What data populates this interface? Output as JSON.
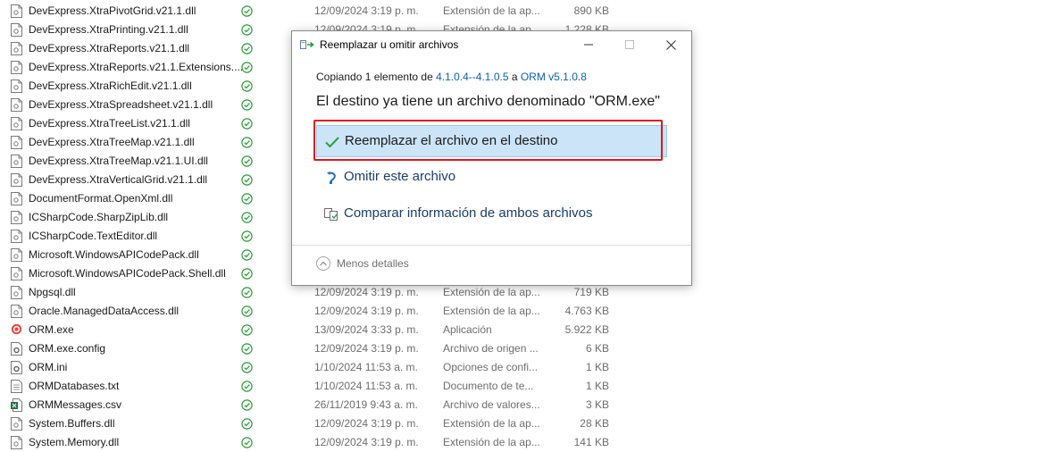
{
  "files": [
    {
      "name": "DevExpress.XtraPivotGrid.v21.1.dll",
      "date": "12/09/2024 3:19 p. m.",
      "type": "Extensión de la ap...",
      "size": "890 KB",
      "icon": "dll-file-icon"
    },
    {
      "name": "DevExpress.XtraPrinting.v21.1.dll",
      "date": "12/09/2024 3:19 p. m.",
      "type": "Extensión de la ap...",
      "size": "1.228 KB",
      "icon": "dll-file-icon"
    },
    {
      "name": "DevExpress.XtraReports.v21.1.dll",
      "date": "",
      "type": "",
      "size": "",
      "icon": "dll-file-icon"
    },
    {
      "name": "DevExpress.XtraReports.v21.1.Extensions....",
      "date": "",
      "type": "",
      "size": "",
      "icon": "dll-file-icon"
    },
    {
      "name": "DevExpress.XtraRichEdit.v21.1.dll",
      "date": "",
      "type": "",
      "size": "",
      "icon": "dll-file-icon"
    },
    {
      "name": "DevExpress.XtraSpreadsheet.v21.1.dll",
      "date": "",
      "type": "",
      "size": "",
      "icon": "dll-file-icon"
    },
    {
      "name": "DevExpress.XtraTreeList.v21.1.dll",
      "date": "",
      "type": "",
      "size": "",
      "icon": "dll-file-icon"
    },
    {
      "name": "DevExpress.XtraTreeMap.v21.1.dll",
      "date": "",
      "type": "",
      "size": "",
      "icon": "dll-file-icon"
    },
    {
      "name": "DevExpress.XtraTreeMap.v21.1.UI.dll",
      "date": "",
      "type": "",
      "size": "",
      "icon": "dll-file-icon"
    },
    {
      "name": "DevExpress.XtraVerticalGrid.v21.1.dll",
      "date": "",
      "type": "",
      "size": "",
      "icon": "dll-file-icon"
    },
    {
      "name": "DocumentFormat.OpenXml.dll",
      "date": "",
      "type": "",
      "size": "",
      "icon": "dll-file-icon"
    },
    {
      "name": "ICSharpCode.SharpZipLib.dll",
      "date": "",
      "type": "",
      "size": "",
      "icon": "dll-file-icon"
    },
    {
      "name": "ICSharpCode.TextEditor.dll",
      "date": "",
      "type": "",
      "size": "",
      "icon": "dll-file-icon"
    },
    {
      "name": "Microsoft.WindowsAPICodePack.dll",
      "date": "",
      "type": "",
      "size": "",
      "icon": "dll-file-icon"
    },
    {
      "name": "Microsoft.WindowsAPICodePack.Shell.dll",
      "date": "",
      "type": "",
      "size": "",
      "icon": "dll-file-icon"
    },
    {
      "name": "Npgsql.dll",
      "date": "12/09/2024 3:19 p. m.",
      "type": "Extensión de la ap...",
      "size": "719 KB",
      "icon": "dll-file-icon"
    },
    {
      "name": "Oracle.ManagedDataAccess.dll",
      "date": "12/09/2024 3:19 p. m.",
      "type": "Extensión de la ap...",
      "size": "4.763 KB",
      "icon": "dll-file-icon"
    },
    {
      "name": "ORM.exe",
      "date": "13/09/2024 3:33 p. m.",
      "type": "Aplicación",
      "size": "5.922 KB",
      "icon": "exe-app-icon"
    },
    {
      "name": "ORM.exe.config",
      "date": "12/09/2024 3:19 p. m.",
      "type": "Archivo de origen ...",
      "size": "6 KB",
      "icon": "config-file-icon"
    },
    {
      "name": "ORM.ini",
      "date": "1/10/2024 11:53 a. m.",
      "type": "Opciones de confi...",
      "size": "1 KB",
      "icon": "ini-file-icon"
    },
    {
      "name": "ORMDatabases.txt",
      "date": "1/10/2024 11:53 a. m.",
      "type": "Documento de te...",
      "size": "1 KB",
      "icon": "text-file-icon"
    },
    {
      "name": "ORMMessages.csv",
      "date": "26/11/2019 9:43 a. m.",
      "type": "Archivo de valores...",
      "size": "3 KB",
      "icon": "csv-file-icon"
    },
    {
      "name": "System.Buffers.dll",
      "date": "12/09/2024 3:19 p. m.",
      "type": "Extensión de la ap...",
      "size": "28 KB",
      "icon": "dll-file-icon"
    },
    {
      "name": "System.Memory.dll",
      "date": "12/09/2024 3:19 p. m.",
      "type": "Extensión de la ap...",
      "size": "141 KB",
      "icon": "dll-file-icon"
    }
  ],
  "dialog": {
    "title": "Reemplazar u omitir archivos",
    "copy_prefix": "Copiando 1 elemento de ",
    "copy_source": "4.1.0.4--4.1.0.5",
    "copy_mid": " a ",
    "copy_dest": "ORM v5.1.0.8",
    "heading": "El destino ya tiene un archivo denominado \"ORM.exe\"",
    "options": [
      {
        "label": "Reemplazar el archivo en el destino",
        "icon": "checkmark-icon"
      },
      {
        "label": "Omitir este archivo",
        "icon": "skip-arrow-icon"
      },
      {
        "label": "Comparar información de ambos archivos",
        "icon": "compare-files-icon"
      }
    ],
    "less_details": "Menos detalles"
  },
  "colors": {
    "accent_link": "#0b5fb5",
    "selected_bg": "#cce4f7",
    "highlight_border": "#e0161b",
    "sync_green": "#2e9d3a"
  }
}
